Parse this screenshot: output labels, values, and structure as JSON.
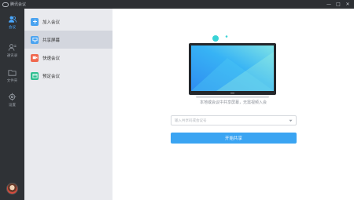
{
  "window": {
    "title": "腾讯会议",
    "controls": {
      "minimize": "—",
      "maximize": "□",
      "close": "✕"
    }
  },
  "leftnav": {
    "items": [
      {
        "label": "会议",
        "icon": "people-icon",
        "active": true
      },
      {
        "label": "通讯录",
        "icon": "contacts-icon",
        "active": false
      },
      {
        "label": "文件夹",
        "icon": "folder-icon",
        "active": false
      },
      {
        "label": "设置",
        "icon": "gear-icon",
        "active": false
      }
    ]
  },
  "subnav": {
    "items": [
      {
        "label": "加入会议",
        "icon": "join-icon",
        "color": "#4aa3f0",
        "active": false
      },
      {
        "label": "共享屏幕",
        "icon": "share-screen-icon",
        "color": "#4aa3f0",
        "active": true
      },
      {
        "label": "快速会议",
        "icon": "video-icon",
        "color": "#f0694f",
        "active": false
      },
      {
        "label": "预定会议",
        "icon": "calendar-icon",
        "color": "#2ebf91",
        "active": false
      }
    ]
  },
  "main": {
    "description": "本地或会议中共享屏幕，无需视频入会",
    "select": {
      "placeholder": "输入共享码或会议号"
    },
    "start_button": "开始共享"
  },
  "colors": {
    "accent": "#3aa4f2",
    "sidebar_dark": "#2f3236",
    "subnav_bg": "#e9eaee"
  }
}
